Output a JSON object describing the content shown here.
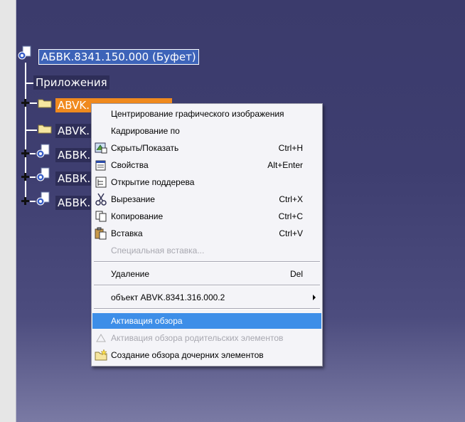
{
  "tree": {
    "root_label": "АБВК.8341.150.000 (Буфет)",
    "applications_label": "Приложения",
    "child_labels": [
      "ABVK.",
      "ABVK.",
      "АБВК.",
      "АБВК.",
      "АБВК."
    ]
  },
  "context_menu": {
    "items": [
      {
        "label": "Центрирование графического изображения",
        "shortcut": ""
      },
      {
        "label": "Кадрирование по",
        "shortcut": ""
      },
      {
        "label": "Скрыть/Показать",
        "shortcut": "Ctrl+H"
      },
      {
        "label": "Свойства",
        "shortcut": "Alt+Enter"
      },
      {
        "label": "Открытие поддерева",
        "shortcut": ""
      },
      {
        "label": "Вырезание",
        "shortcut": "Ctrl+X"
      },
      {
        "label": "Копирование",
        "shortcut": "Ctrl+C"
      },
      {
        "label": "Вставка",
        "shortcut": "Ctrl+V"
      },
      {
        "label": "Специальная вставка...",
        "shortcut": ""
      },
      {
        "label": "Удаление",
        "shortcut": "Del"
      },
      {
        "label": "объект ABVK.8341.316.000.2",
        "shortcut": ""
      },
      {
        "label": "Активация обзора",
        "shortcut": ""
      },
      {
        "label": "Активация обзора родительских элементов",
        "shortcut": ""
      },
      {
        "label": "Создание обзора дочерних элементов",
        "shortcut": ""
      }
    ]
  },
  "colors": {
    "selection_orange": "#f08a1e",
    "menu_highlight": "#3d8ee8",
    "background": "#3e3e70"
  }
}
